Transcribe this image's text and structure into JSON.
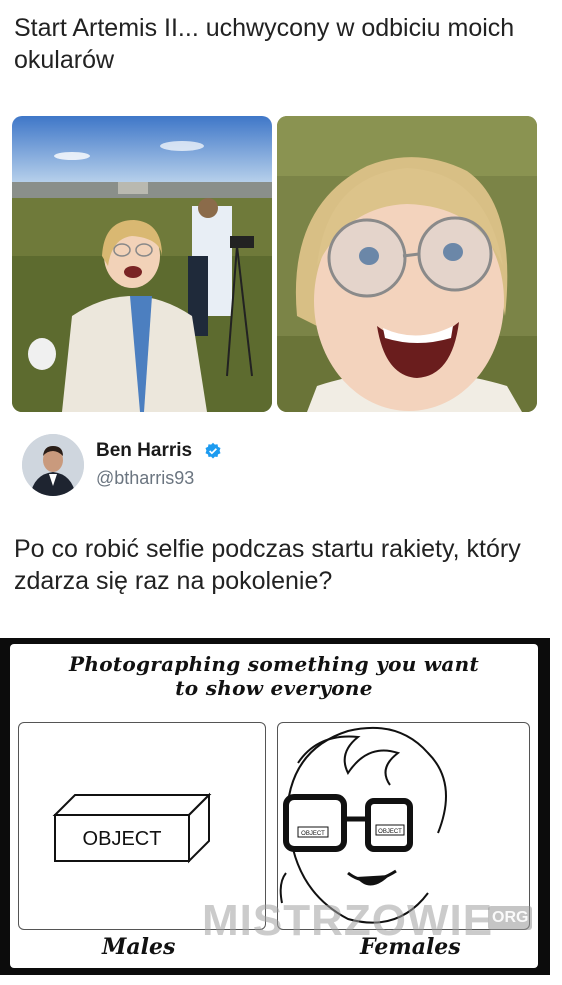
{
  "post": {
    "caption_top": "Start Artemis II... uchwycony w odbiciu moich okularów",
    "question": "Po co robić selfie podczas startu rakiety, który zdarza się raz na pokolenie?"
  },
  "author": {
    "name": "Ben Harris",
    "handle": "@btharris93",
    "verified_color": "#1d9bf0"
  },
  "comic": {
    "title_line1": "Photographing something you want",
    "title_line2": "to show everyone",
    "object_label": "OBJECT",
    "glasses_label": "OBJECT",
    "label_left": "Males",
    "label_right": "Females"
  },
  "watermark": {
    "text": "MISTRZOWIE",
    "suffix": "ORG"
  }
}
